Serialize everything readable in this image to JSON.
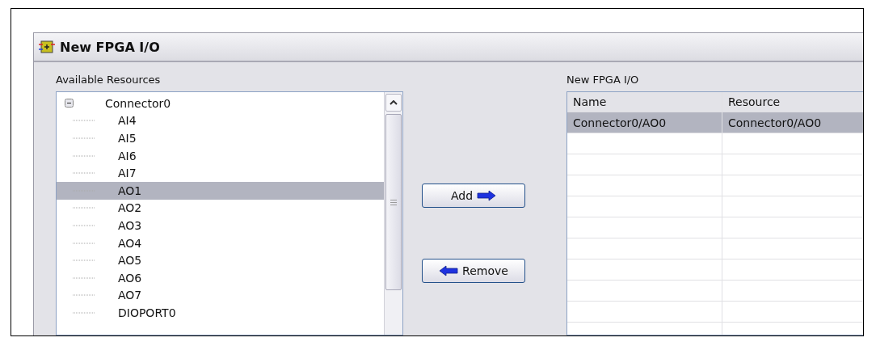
{
  "window": {
    "title": "New FPGA I/O"
  },
  "available_resources": {
    "label": "Available Resources",
    "tree": [
      {
        "label": "Connector0",
        "expanded": true,
        "selected": false,
        "children": [
          {
            "label": "AI4",
            "selected": false
          },
          {
            "label": "AI5",
            "selected": false
          },
          {
            "label": "AI6",
            "selected": false
          },
          {
            "label": "AI7",
            "selected": false
          },
          {
            "label": "AO1",
            "selected": true
          },
          {
            "label": "AO2",
            "selected": false
          },
          {
            "label": "AO3",
            "selected": false
          },
          {
            "label": "AO4",
            "selected": false
          },
          {
            "label": "AO5",
            "selected": false
          },
          {
            "label": "AO6",
            "selected": false
          },
          {
            "label": "AO7",
            "selected": false
          },
          {
            "label": "DIOPORT0",
            "selected": false
          }
        ]
      }
    ]
  },
  "buttons": [
    {
      "kind": "add",
      "label": "Add"
    },
    {
      "kind": "remove",
      "label": "Remove"
    }
  ],
  "new_io": {
    "label": "New FPGA I/O",
    "columns": [
      "Name",
      "Resource"
    ],
    "rows": [
      {
        "cells": [
          "Connector0/AO0",
          "Connector0/AO0"
        ],
        "selected": true
      }
    ]
  }
}
